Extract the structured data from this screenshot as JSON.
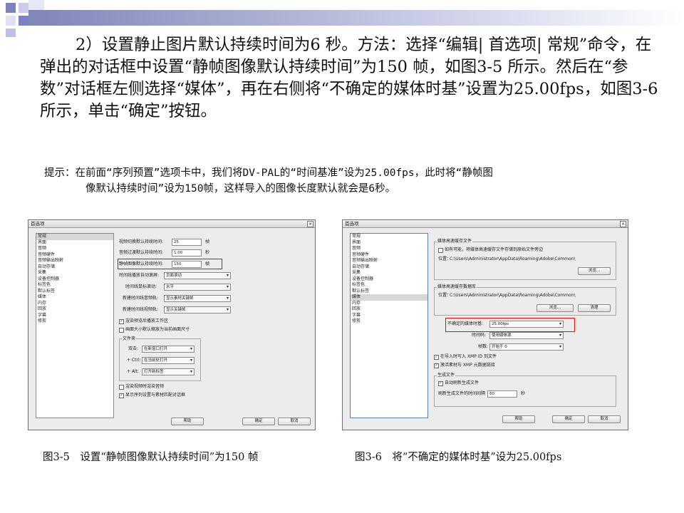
{
  "paragraph": "2）设置静止图片默认持续时间为6 秒。方法：选择“编辑| 首选项| 常规”命令，在弹出的对话框中设置“静帧图像默认持续时间”为150 帧，如图3-5 所示。然后在“参数”对话框左侧选择“媒体”，再在右侧将“不确定的媒体时基”设置为25.00fps，如图3-6 所示，单击“确定”按钮。",
  "tip": {
    "line1": "提示：在前面“序列预置”选项卡中，我们将DV-PAL的“时间基准”设为25.00fps，此时将“静帧图",
    "line2": "像默认持续时间”设为150帧，这样导入的图像长度默认就会是6秒。"
  },
  "dialog_left": {
    "title": "首选项",
    "close": "×",
    "categories": [
      "常规",
      "界面",
      "音频",
      "音频硬件",
      "音频输出映射",
      "自动存储",
      "采集",
      "设备控制器",
      "标签色",
      "默认标签",
      "媒体",
      "内存",
      "回放",
      "字幕",
      "修剪"
    ],
    "selected_category": "常规",
    "rows": [
      {
        "label": "视频切换默认持续时间:",
        "value": "25",
        "unit": "帧"
      },
      {
        "label": "音频过渡默认持续时间:",
        "value": "1.00",
        "unit": "秒"
      },
      {
        "label": "静帧图像默认持续时间:",
        "value": "150",
        "unit": "帧"
      }
    ],
    "dropdowns": [
      {
        "label": "时间线播放自动滚屏:",
        "value": "页面滚动"
      },
      {
        "label": "时间线鼠标滚动:",
        "value": "水平"
      },
      {
        "label": "新建时间线音频轨:",
        "value": "显示素材关键帧"
      },
      {
        "label": "新建时间线视频轨:",
        "value": "显示关键帧"
      }
    ],
    "checks": [
      "渲染预览后播放工作区",
      "画面大小默认缩放为当前画面尺寸"
    ],
    "bin_group": {
      "title": "文件夹",
      "rows": [
        {
          "label": "双击:",
          "value": "在新窗口打开"
        },
        {
          "label": "+ Ctrl:",
          "value": "在当前处打开"
        },
        {
          "label": "+ Alt:",
          "value": "打开新标签"
        }
      ]
    },
    "checks2": [
      "渲染视频时渲染音频",
      "显示序列设置与素材匹配对话框"
    ],
    "buttons": [
      "帮助",
      "确定",
      "取消"
    ]
  },
  "dialog_right": {
    "title": "首选项",
    "close": "×",
    "categories": [
      "常规",
      "界面",
      "音频",
      "音频硬件",
      "音频输出映射",
      "自动存储",
      "采集",
      "设备控制器",
      "标签色",
      "默认标签",
      "媒体",
      "内存",
      "回放",
      "字幕",
      "修剪"
    ],
    "selected_category": "媒体",
    "cache_files": {
      "title": "媒体高速缓存文件",
      "check": "如有可能，将媒体高速缓存文件存储到原始文件旁边",
      "location_label": "位置：",
      "location": "C:\\Users\\Administrator\\AppData\\Roaming\\Adobe\\Common\\",
      "browse": "浏览..."
    },
    "cache_db": {
      "title": "媒体高速缓存数据库",
      "location_label": "位置：",
      "location": "C:\\Users\\Administrator\\AppData\\Roaming\\Adobe\\Common\\",
      "browse": "浏览...",
      "clean": "清理"
    },
    "timebase": {
      "label": "不确定的媒体时基:",
      "value": "25.00fps"
    },
    "timecode": {
      "label": "时间码:",
      "value": "使用媒体源"
    },
    "frame_count": {
      "label": "帧数:",
      "value": "开始于 0"
    },
    "checks": [
      "在导入时写入 XMP ID 到文件",
      "激活素材与 XMP 元数据链接"
    ],
    "growing": {
      "title": "生成文件",
      "check": "自动刷新生成文件",
      "refresh_label": "刷新生成文件的时间间隔",
      "refresh_value": "60",
      "refresh_unit": "秒"
    },
    "buttons": [
      "帮助",
      "确定",
      "取消"
    ]
  },
  "captions": {
    "left": "图3-5　设置“静帧图像默认持续时间”为150 帧",
    "right": "图3-6　将“不确定的媒体时基”设为25.00fps"
  }
}
